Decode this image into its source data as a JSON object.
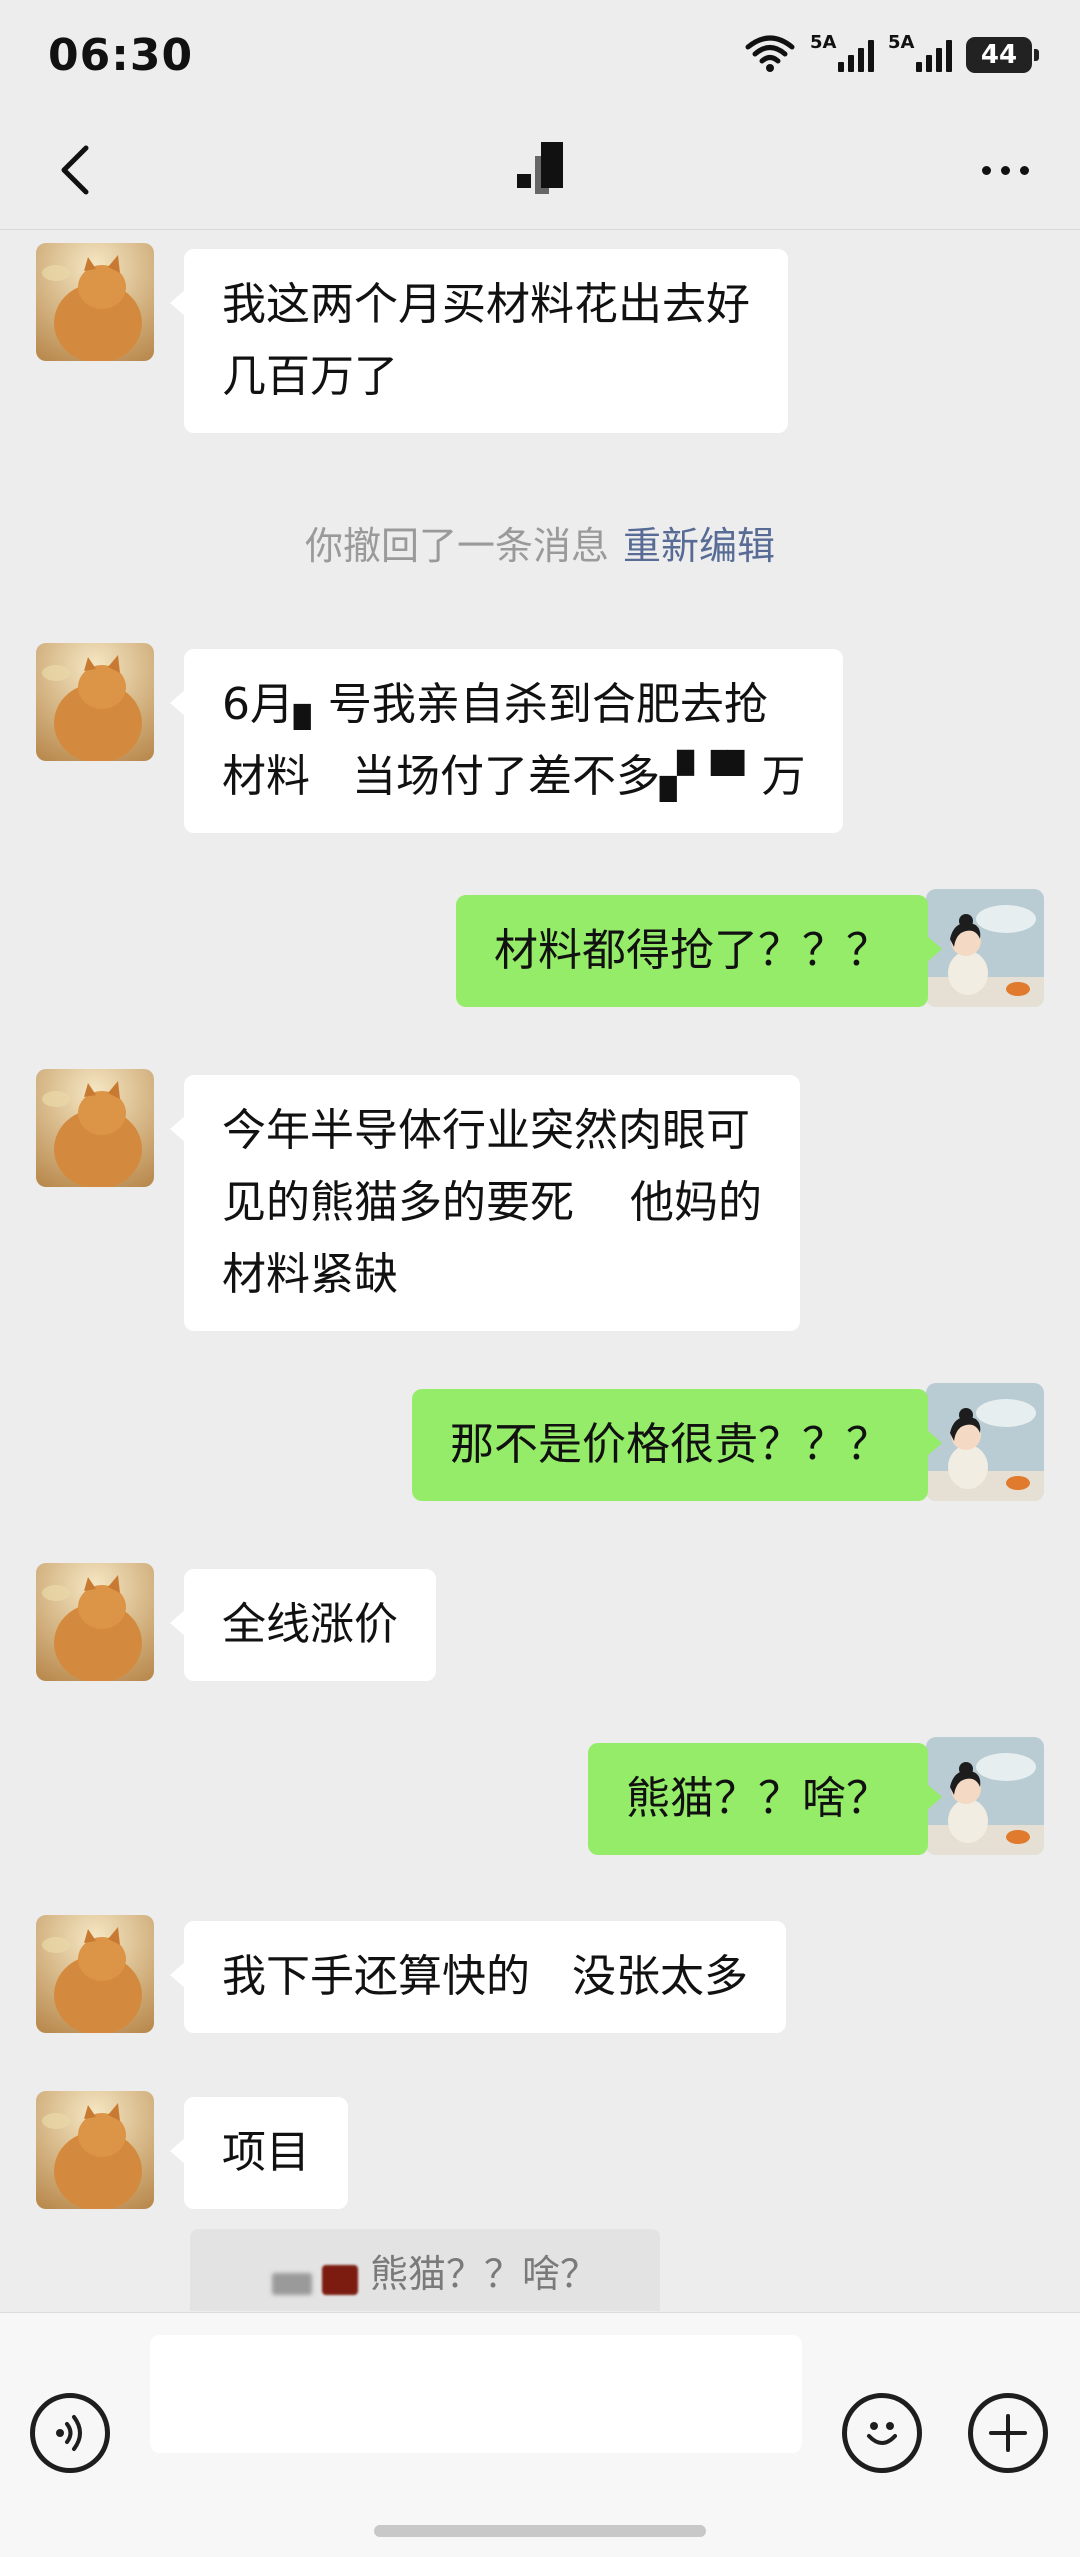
{
  "status_bar": {
    "time": "06:30",
    "signal1_label": "5A",
    "signal2_label": "5A",
    "battery": "44"
  },
  "nav": {
    "back_icon": "chevron-left-icon",
    "more_icon": "more-dots-icon"
  },
  "messages": [
    {
      "side": "in",
      "text": "我这两个月买材料花出去好\n几百万了"
    },
    {
      "type": "system",
      "text": "你撤回了一条消息",
      "link": "重新编辑"
    },
    {
      "side": "in",
      "text": "6月▖号我亲自杀到合肥去抢\n材料   当场付了差不多▞▝▘万"
    },
    {
      "side": "out",
      "text": "材料都得抢了？？？"
    },
    {
      "side": "in",
      "text": "今年半导体行业突然肉眼可\n见的熊猫多的要死    他妈的\n材料紧缺"
    },
    {
      "side": "out",
      "text": "那不是价格很贵？？？"
    },
    {
      "side": "in",
      "text": "全线涨价"
    },
    {
      "side": "out",
      "text": "熊猫？？啥？"
    },
    {
      "side": "in",
      "text": "我下手还算快的   没张太多"
    },
    {
      "side": "in",
      "text": "项目"
    }
  ],
  "quote": {
    "text": "熊猫？？啥？"
  },
  "input_bar": {
    "voice_icon": "voice-icon",
    "emoji_icon": "emoji-icon",
    "plus_icon": "plus-icon",
    "input_value": ""
  },
  "colors": {
    "background": "#ededed",
    "incoming_bubble": "#ffffff",
    "outgoing_bubble": "#95ec69",
    "link": "#576b95"
  }
}
